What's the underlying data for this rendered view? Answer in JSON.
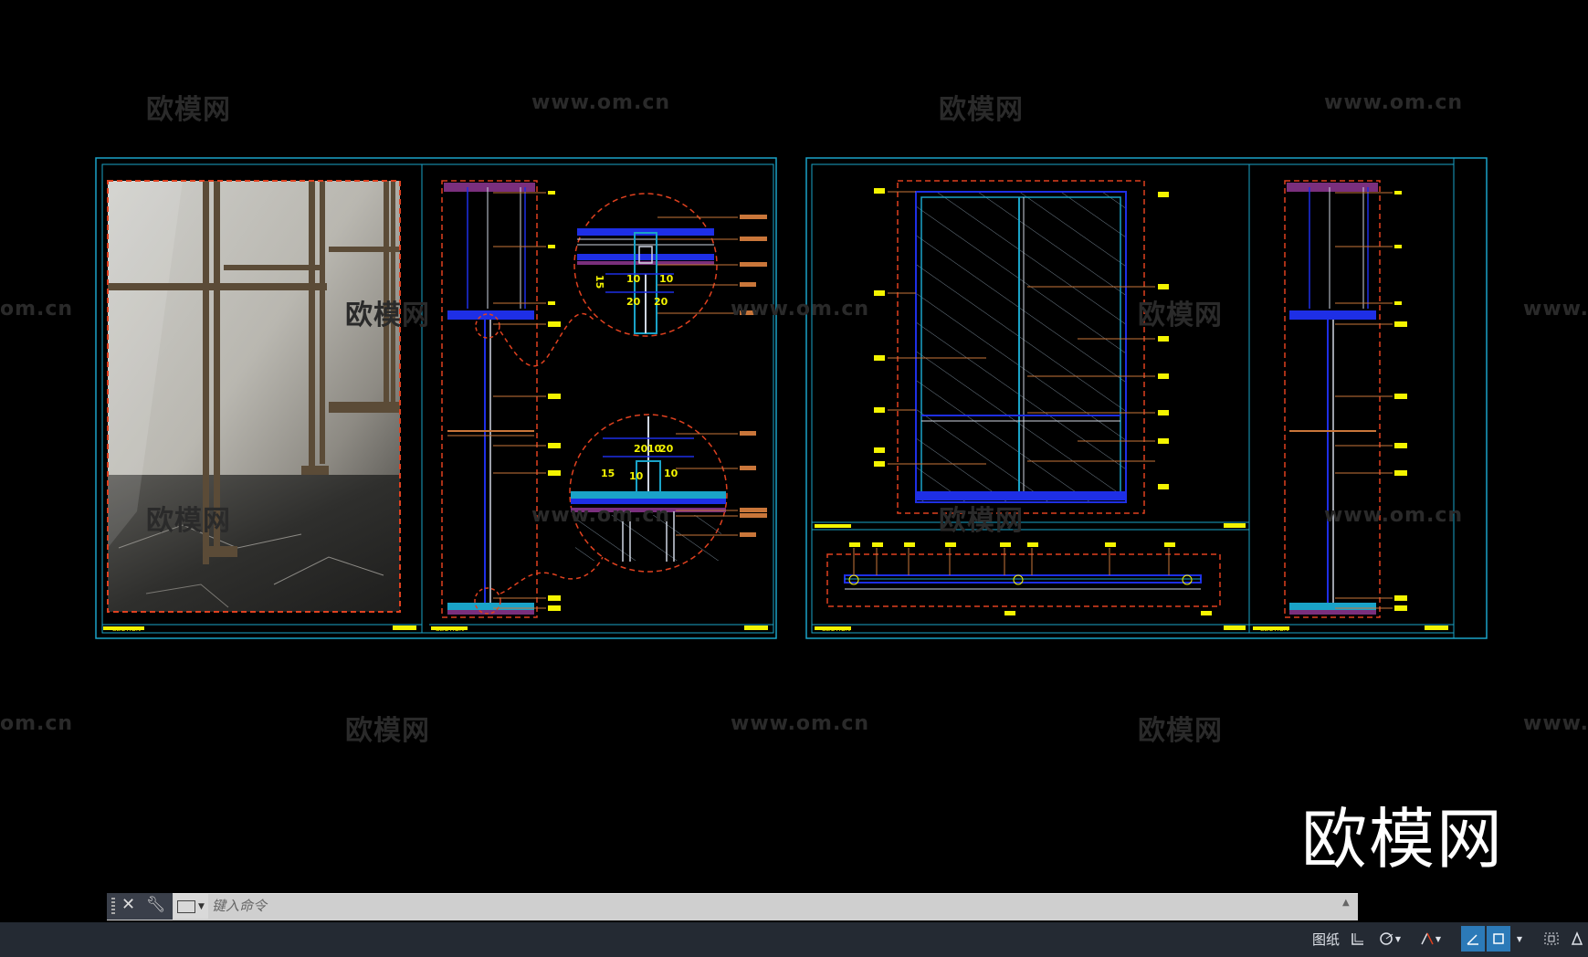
{
  "watermarks": {
    "brand": "欧模网",
    "url": "www.om.cn",
    "url_partial_left": "om.cn",
    "url_partial_right": "www."
  },
  "logo": {
    "text": "欧模网"
  },
  "drawing": {
    "section_label": "SECTION",
    "detail_dims_top": [
      "15",
      "10",
      "10",
      "20",
      "20"
    ],
    "detail_dims_bottom": [
      "20",
      "10",
      "20",
      "15",
      "10",
      "10"
    ]
  },
  "command_line": {
    "close_icon": "close-icon",
    "customize_icon": "wrench-icon",
    "placeholder": "键入命令"
  },
  "status_bar": {
    "layout_label": "图纸",
    "icons": [
      "grid-icon",
      "ortho-icon",
      "polar-icon",
      "osnap-icon",
      "lineweight-icon",
      "transparency-icon",
      "selection-cycling-icon",
      "annotation-icon"
    ]
  },
  "colors": {
    "background": "#000000",
    "frame": "#1aa3c8",
    "red_dash": "#e0411f",
    "blue": "#1e2fe6",
    "yellow": "#f4f400",
    "orange_leader": "#c9763a",
    "status_active": "#2c7ab8"
  }
}
